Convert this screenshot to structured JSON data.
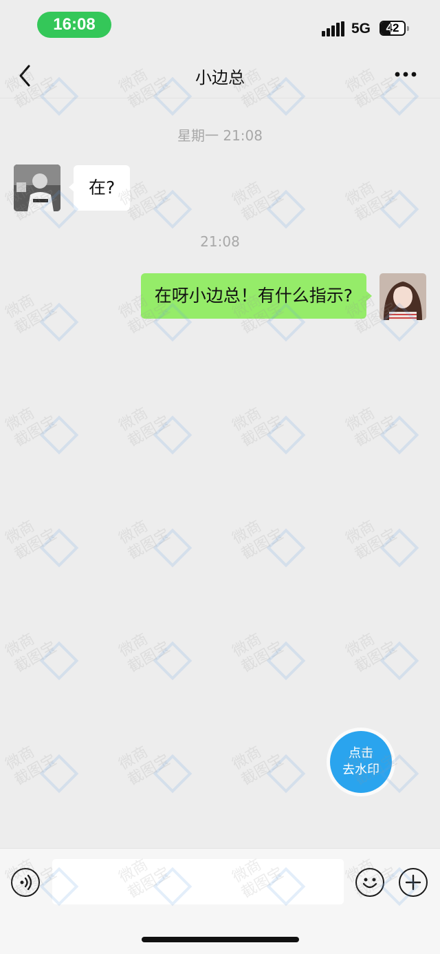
{
  "status_bar": {
    "time": "16:08",
    "network": "5G",
    "battery_level": "42",
    "battery_fraction": 0.42,
    "time_pill_color": "#34C759"
  },
  "nav": {
    "title": "小边总",
    "back_icon": "chevron-left-icon",
    "more_icon": "more-horizontal-icon"
  },
  "messages": [
    {
      "type": "timestamp",
      "text": "星期一 21:08"
    },
    {
      "type": "incoming",
      "text": "在?",
      "avatar": "contact-avatar"
    },
    {
      "type": "timestamp",
      "text": "21:08"
    },
    {
      "type": "outgoing",
      "text": "在呀小边总！有什么指示?",
      "avatar": "self-avatar"
    }
  ],
  "fab": {
    "line1": "点击",
    "line2": "去水印",
    "color": "#2AA4EE"
  },
  "input_bar": {
    "voice_icon": "voice-icon",
    "emoji_icon": "emoji-icon",
    "plus_icon": "plus-icon",
    "input_value": ""
  },
  "watermark": {
    "line1": "微商",
    "line2": "截图宝"
  },
  "colors": {
    "background": "#EDEDED",
    "bubble_outgoing": "#95EC69",
    "bubble_incoming": "#FFFFFF",
    "timestamp": "#A8A8A8"
  }
}
